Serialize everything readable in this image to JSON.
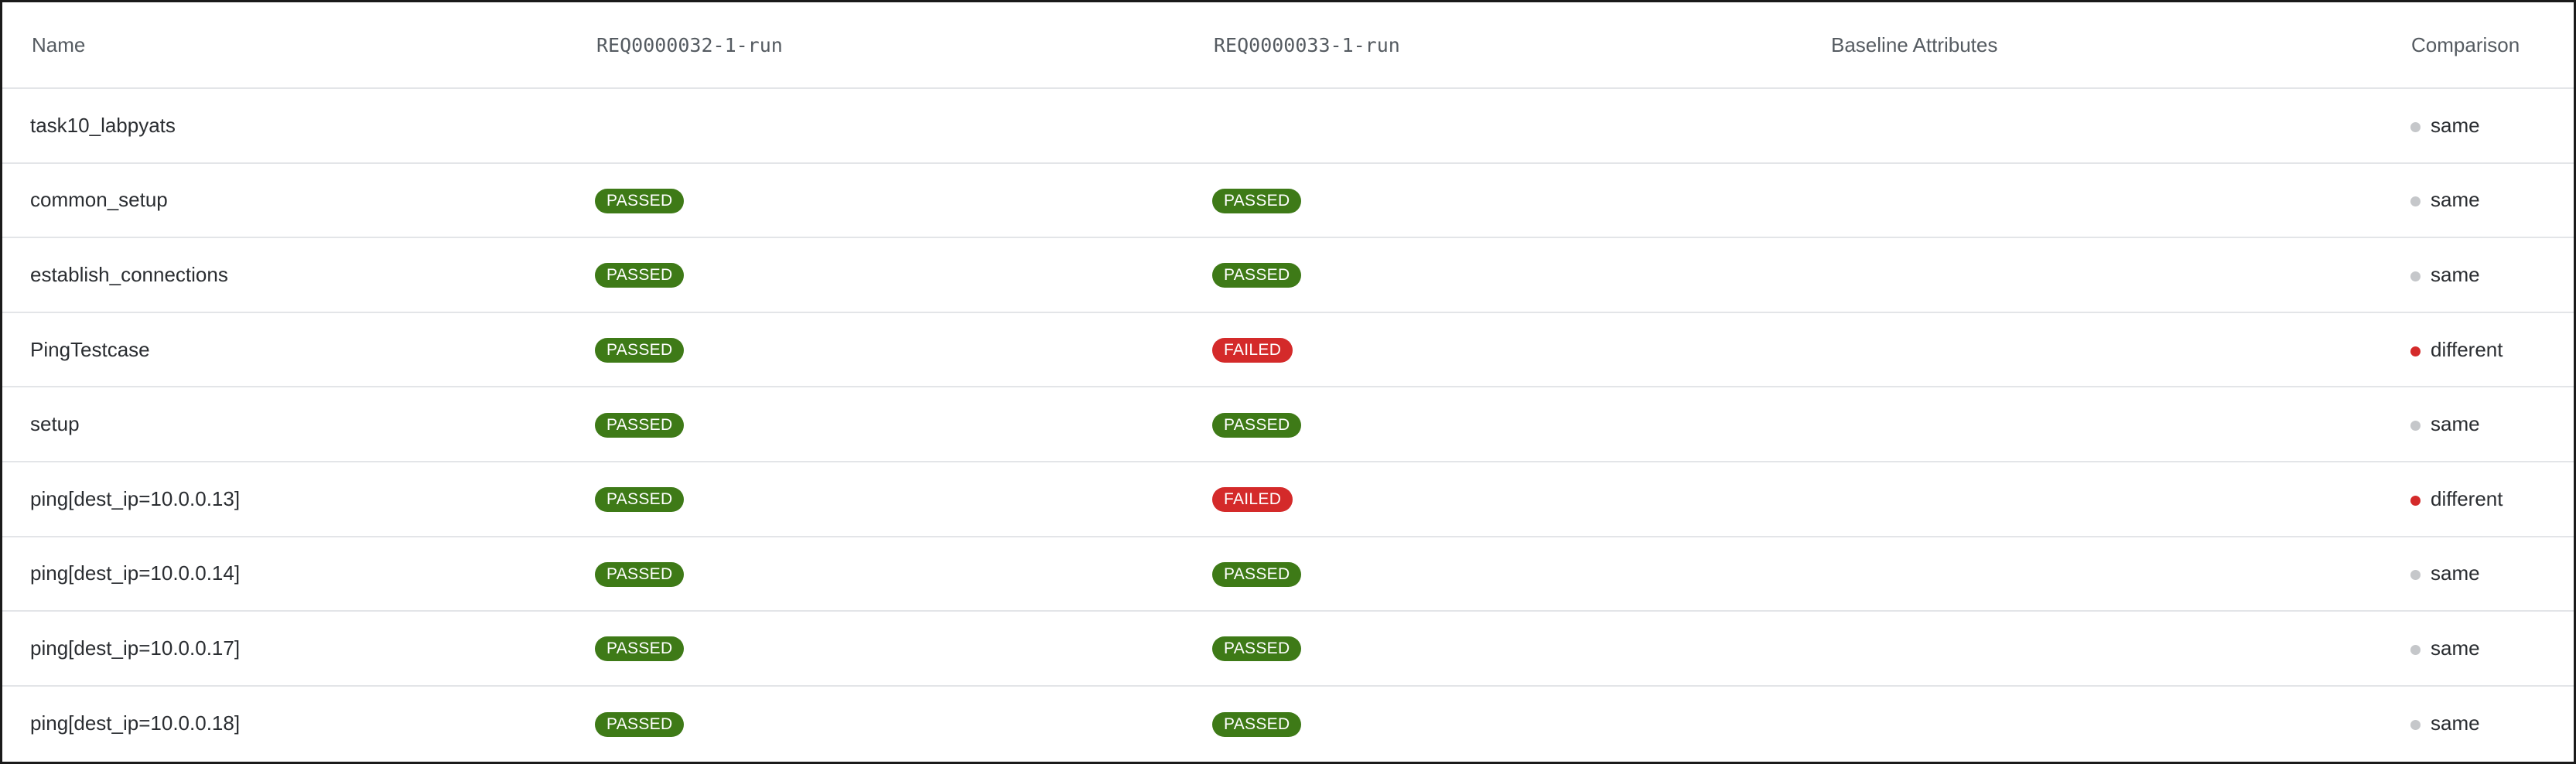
{
  "table": {
    "headers": {
      "name": "Name",
      "run1": "REQ0000032-1-run",
      "run2": "REQ0000033-1-run",
      "baseline": "Baseline Attributes",
      "comparison": "Comparison"
    },
    "rows": [
      {
        "name": "task10_labpyats",
        "run1": "",
        "run2": "",
        "baseline": "",
        "comparison": "same"
      },
      {
        "name": "common_setup",
        "run1": "PASSED",
        "run2": "PASSED",
        "baseline": "",
        "comparison": "same"
      },
      {
        "name": "establish_connections",
        "run1": "PASSED",
        "run2": "PASSED",
        "baseline": "",
        "comparison": "same"
      },
      {
        "name": "PingTestcase",
        "run1": "PASSED",
        "run2": "FAILED",
        "baseline": "",
        "comparison": "different"
      },
      {
        "name": "setup",
        "run1": "PASSED",
        "run2": "PASSED",
        "baseline": "",
        "comparison": "same"
      },
      {
        "name": "ping[dest_ip=10.0.0.13]",
        "run1": "PASSED",
        "run2": "FAILED",
        "baseline": "",
        "comparison": "different"
      },
      {
        "name": "ping[dest_ip=10.0.0.14]",
        "run1": "PASSED",
        "run2": "PASSED",
        "baseline": "",
        "comparison": "same"
      },
      {
        "name": "ping[dest_ip=10.0.0.17]",
        "run1": "PASSED",
        "run2": "PASSED",
        "baseline": "",
        "comparison": "same"
      },
      {
        "name": "ping[dest_ip=10.0.0.18]",
        "run1": "PASSED",
        "run2": "PASSED",
        "baseline": "",
        "comparison": "same"
      }
    ]
  },
  "colors": {
    "passed": "#3e7a17",
    "failed": "#d42a2a",
    "same_dot": "#c5c7ca",
    "different_dot": "#d42a2a"
  }
}
